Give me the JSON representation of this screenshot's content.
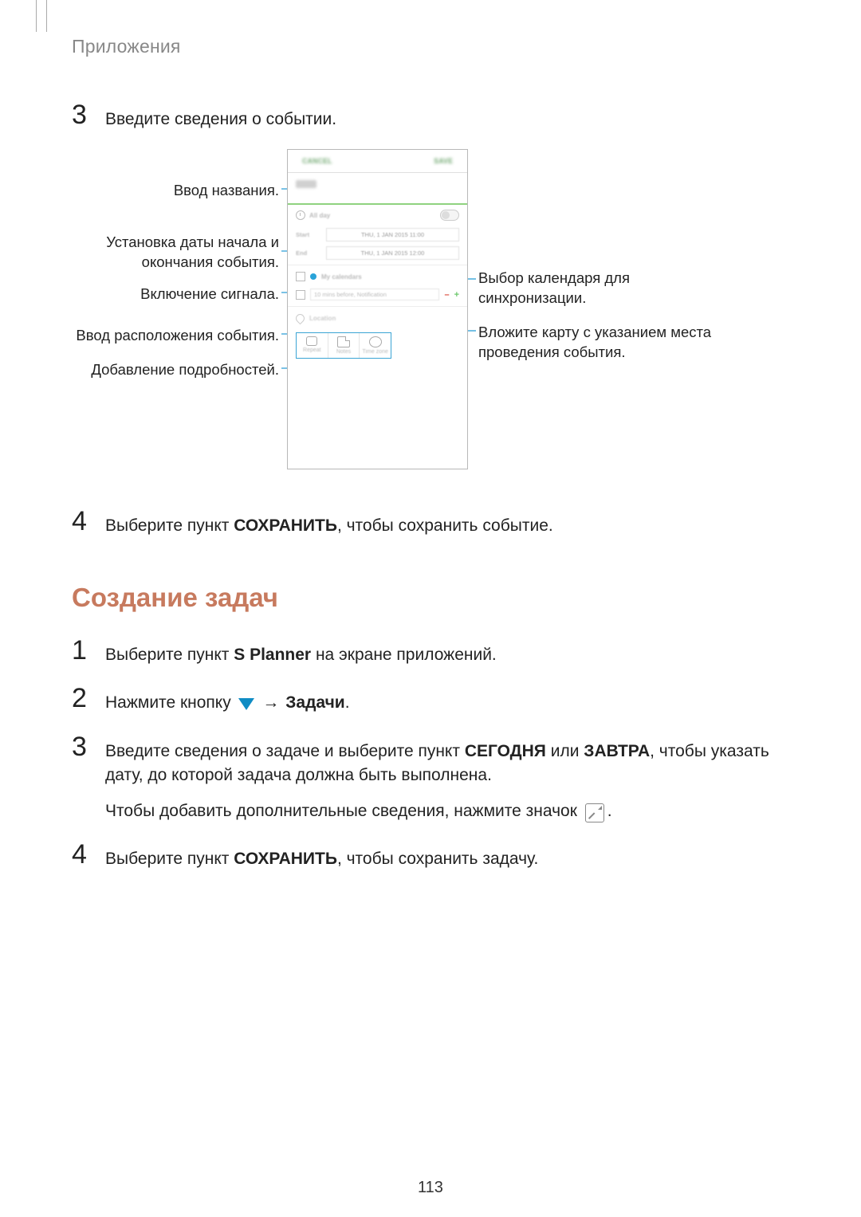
{
  "breadcrumb": "Приложения",
  "page_number": "113",
  "section1": {
    "step3": {
      "num": "3",
      "text": "Введите сведения о событии."
    },
    "step4": {
      "num": "4",
      "prefix": "Выберите пункт ",
      "bold": "СОХРАНИТЬ",
      "suffix": ", чтобы сохранить событие."
    }
  },
  "callouts": {
    "left": {
      "c1": "Ввод названия.",
      "c2": "Установка даты начала и окончания события.",
      "c3": "Включение сигнала.",
      "c4": "Ввод расположения события.",
      "c5": "Добавление подробностей."
    },
    "right": {
      "c1": "Выбор календаря для синхронизации.",
      "c2": "Вложите карту с указанием места проведения события."
    }
  },
  "phone": {
    "cancel": "CANCEL",
    "save": "SAVE",
    "title": "Title",
    "allday": "All day",
    "start": "Start",
    "end": "End",
    "start_val": "THU, 1 JAN 2015   11:00",
    "end_val": "THU, 1 JAN 2015   12:00",
    "calendar": "My calendars",
    "notif": "10 mins before, Notification",
    "location": "Location",
    "btn_repeat": "Repeat",
    "btn_notes": "Notes",
    "btn_tz": "Time zone"
  },
  "heading2": "Создание задач",
  "section2": {
    "step1": {
      "num": "1",
      "prefix": "Выберите пункт ",
      "bold": "S Planner",
      "suffix": " на экране приложений."
    },
    "step2": {
      "num": "2",
      "prefix": "Нажмите кнопку ",
      "arrow": "→",
      "bold": "Задачи",
      "suffix": "."
    },
    "step3": {
      "num": "3",
      "line1_prefix": "Введите сведения о задаче и выберите пункт ",
      "line1_b1": "СЕГОДНЯ",
      "line1_mid": " или ",
      "line1_b2": "ЗАВТРА",
      "line1_suffix": ", чтобы указать дату, до которой задача должна быть выполнена.",
      "line2_prefix": "Чтобы добавить дополнительные сведения, нажмите значок ",
      "line2_suffix": "."
    },
    "step4": {
      "num": "4",
      "prefix": "Выберите пункт ",
      "bold": "СОХРАНИТЬ",
      "suffix": ", чтобы сохранить задачу."
    }
  }
}
